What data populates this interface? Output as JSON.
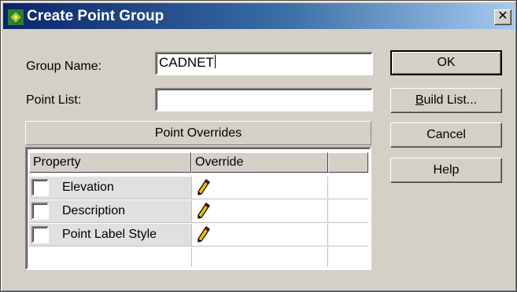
{
  "window": {
    "title": "Create Point Group",
    "close_label": "✕"
  },
  "form": {
    "group_name_label": "Group Name:",
    "group_name_value": "CADNET",
    "point_list_label": "Point List:",
    "point_list_value": ""
  },
  "buttons": {
    "ok": "OK",
    "build_list_prefix": "B",
    "build_list_rest": "uild List...",
    "cancel": "Cancel",
    "help": "Help"
  },
  "overrides": {
    "title": "Point Overrides",
    "columns": [
      "Property",
      "Override",
      ""
    ],
    "rows": [
      {
        "property": "Elevation",
        "checked": false,
        "override_icon": "pencil-icon"
      },
      {
        "property": "Description",
        "checked": false,
        "override_icon": "pencil-icon"
      },
      {
        "property": "Point Label Style",
        "checked": false,
        "override_icon": "pencil-icon"
      }
    ]
  },
  "colors": {
    "face": "#d4d0c8",
    "titlebar_start": "#0a246a",
    "titlebar_end": "#a6caf0",
    "pencil_body": "#f0c000",
    "pencil_tip": "#d00000"
  }
}
